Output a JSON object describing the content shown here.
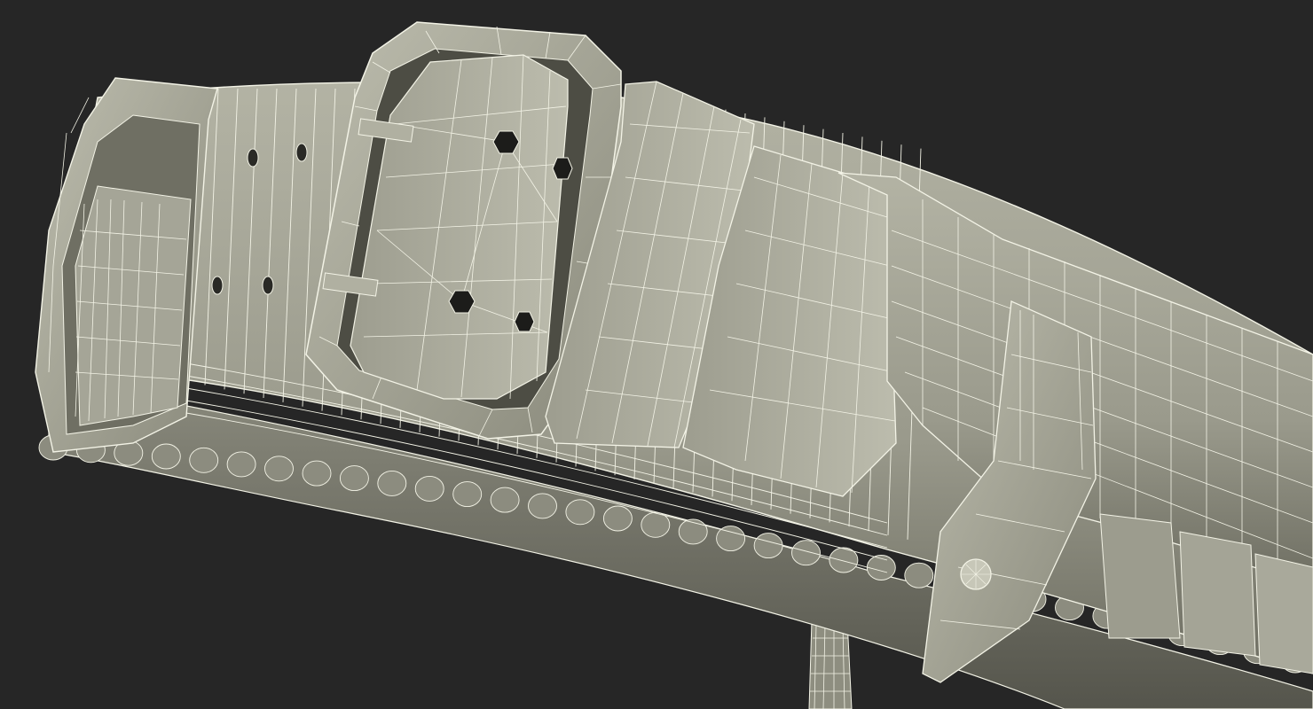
{
  "colors": {
    "background": "#262626",
    "surface_light": "#aeae9f",
    "surface_mid": "#8f8f81",
    "surface_dark": "#66665b",
    "shadow": "#3e3e37",
    "wire": "#f3f3e6"
  }
}
